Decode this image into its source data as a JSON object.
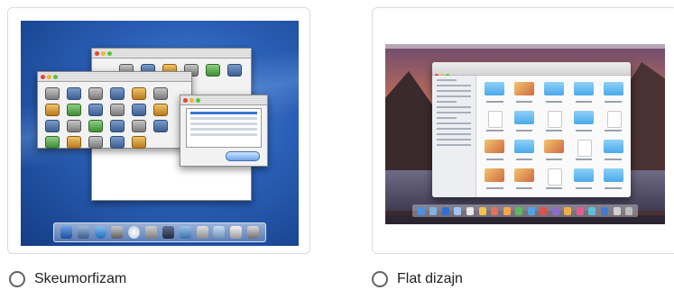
{
  "options": [
    {
      "label": "Skeumorfizam",
      "selected": false,
      "image": "skeuomorphic-desktop-screenshot"
    },
    {
      "label": "Flat dizajn",
      "selected": false,
      "image": "flat-desktop-screenshot"
    }
  ],
  "colors": {
    "card_border": "#dadce0",
    "radio_border": "#5f6368",
    "label_text": "#202124"
  }
}
